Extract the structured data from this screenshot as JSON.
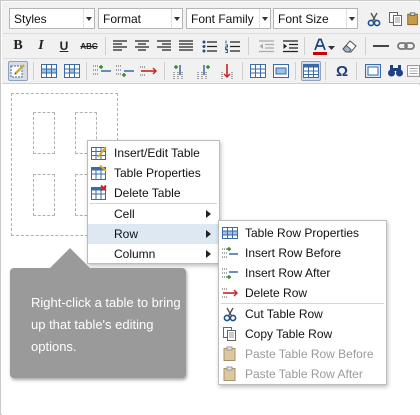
{
  "toolbar": {
    "dropdowns": {
      "styles": "Styles",
      "format": "Format",
      "font_family": "Font Family",
      "font_size": "Font Size"
    },
    "bold": "B",
    "italic": "I",
    "underline": "U",
    "strikethrough": "ABC",
    "omega": "Ω"
  },
  "context_menu": {
    "items": [
      {
        "label": "Insert/Edit Table",
        "icon": "insert-table-icon"
      },
      {
        "label": "Table Properties",
        "icon": "table-properties-icon"
      },
      {
        "label": "Delete Table",
        "icon": "delete-table-icon"
      },
      {
        "label": "Cell",
        "submenu": true
      },
      {
        "label": "Row",
        "submenu": true,
        "highlighted": true
      },
      {
        "label": "Column",
        "submenu": true
      }
    ]
  },
  "row_submenu": {
    "items": [
      {
        "label": "Table Row Properties",
        "enabled": true
      },
      {
        "label": "Insert Row Before",
        "enabled": true
      },
      {
        "label": "Insert Row After",
        "enabled": true
      },
      {
        "label": "Delete Row",
        "enabled": true
      },
      {
        "label": "Cut Table Row",
        "enabled": true
      },
      {
        "label": "Copy Table Row",
        "enabled": true
      },
      {
        "label": "Paste Table Row Before",
        "enabled": false
      },
      {
        "label": "Paste Table Row After",
        "enabled": false
      }
    ]
  },
  "callout": {
    "text": "Right-click a table to bring up that table's editing options."
  },
  "colors": {
    "toolbar_bg": "#f1f1f1",
    "menu_highlight": "#dde8f3",
    "callout_bg": "#9a9a9a",
    "font_color_underline": "#cc0000"
  }
}
